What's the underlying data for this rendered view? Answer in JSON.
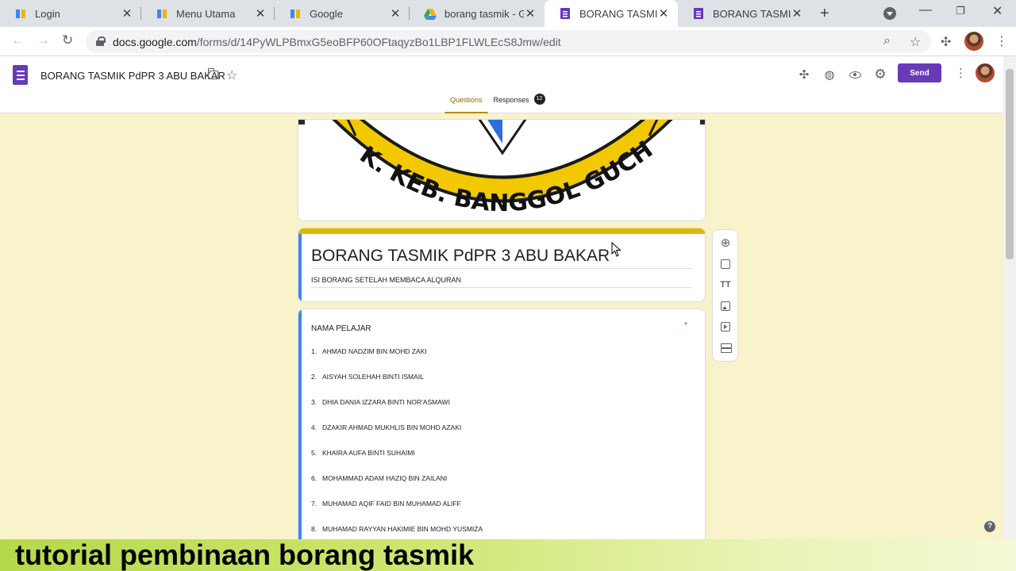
{
  "browser": {
    "tabs": [
      {
        "title": "Login",
        "favicon": "book-icon",
        "color": "#f4b400"
      },
      {
        "title": "Menu Utama",
        "favicon": "book-icon",
        "color": "#f4b400"
      },
      {
        "title": "Google",
        "favicon": "book-icon",
        "color": "#f4b400"
      },
      {
        "title": "borang tasmik - Go",
        "favicon": "drive-icon",
        "color": "#34a853"
      },
      {
        "title": "BORANG TASMIK P",
        "favicon": "forms-icon",
        "color": "#673ab7"
      },
      {
        "title": "BORANG TASMIK TA",
        "favicon": "forms-icon",
        "color": "#673ab7"
      }
    ],
    "url_host": "docs.google.com",
    "url_path": "/forms/d/14PyWLPBmxG5eoBFP60OFtaqyzBo1LBP1FLWLEcS8Jmw/edit"
  },
  "forms": {
    "doc_title": "BORANG TASMIK PdPR 3 ABU BAKAR",
    "send_label": "Send",
    "tabs": {
      "questions": "Questions",
      "responses": "Responses",
      "responses_count": "12"
    },
    "accent_color": "#673ab7"
  },
  "form": {
    "title": "BORANG TASMIK PdPR 3 ABU BAKAR",
    "description": "ISI BORANG SETELAH MEMBACA ALQURAN",
    "header_image_text": "SEK. KEB. BANGGOL GUCHIL",
    "theme_color": "#e0b800",
    "background_color": "#f8f3cb"
  },
  "question": {
    "title": "NAMA PELAJAR",
    "required_mark": "*",
    "options": [
      {
        "num": "1.",
        "label": "AHMAD NADZIM BIN MOHD ZAKI"
      },
      {
        "num": "2.",
        "label": "AISYAH SOLEHAH BINTI ISMAIL"
      },
      {
        "num": "3.",
        "label": "DHIA DANIA IZZARA BINTI NOR'ASMAWI"
      },
      {
        "num": "4.",
        "label": "DZAKIR AHMAD MUKHLIS BIN MOHD AZAKI"
      },
      {
        "num": "5.",
        "label": "KHAIRA AUFA BINTI SUHAIMI"
      },
      {
        "num": "6.",
        "label": "MOHAMMAD ADAM HAZIQ BIN ZAILANI"
      },
      {
        "num": "7.",
        "label": "MUHAMAD AQIF FAID BIN MUHAMAD ALIFF"
      },
      {
        "num": "8.",
        "label": "MUHAMAD RAYYAN HAKIMIE BIN MOHD YUSMIZA"
      }
    ]
  },
  "caption": "tutorial pembinaan borang tasmik"
}
